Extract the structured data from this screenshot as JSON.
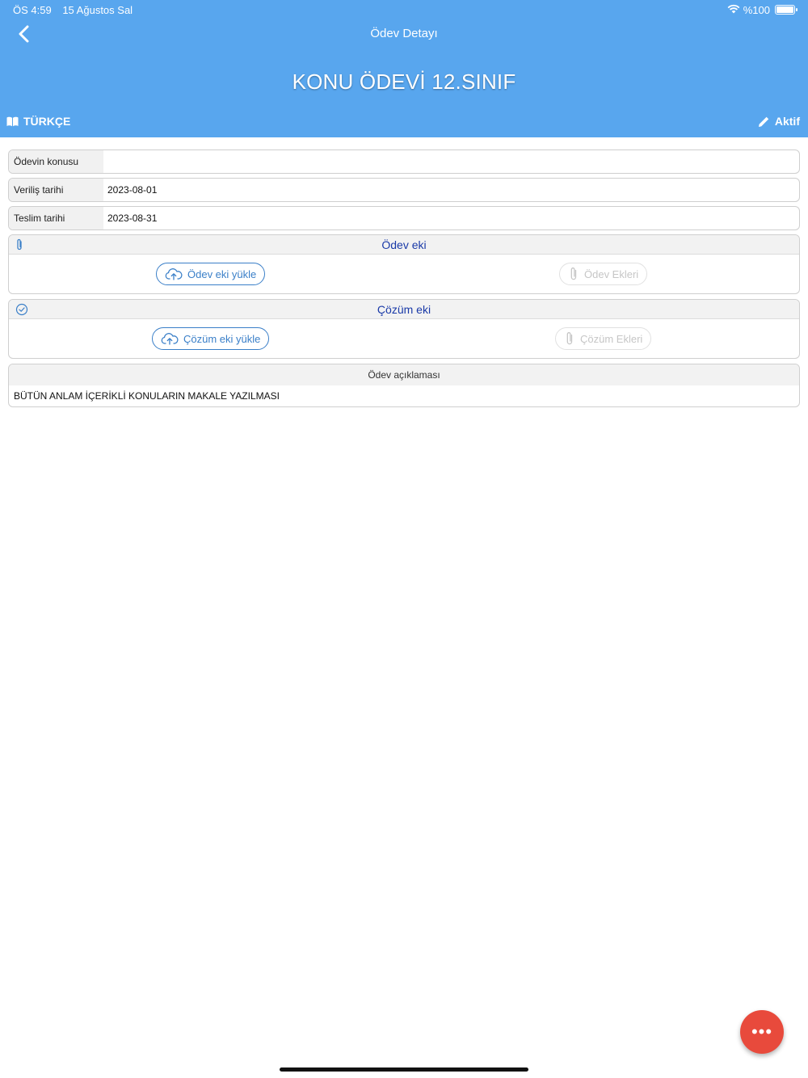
{
  "status_bar": {
    "time": "ÖS 4:59",
    "date": "15 Ağustos Sal",
    "battery": "%100"
  },
  "header": {
    "nav_title": "Ödev Detayı",
    "title": "KONU ÖDEVİ 12.SINIF",
    "subject": "TÜRKÇE",
    "status": "Aktif"
  },
  "fields": [
    {
      "label": "Ödevin konusu",
      "value": ""
    },
    {
      "label": "Veriliş tarihi",
      "value": "2023-08-01"
    },
    {
      "label": "Teslim tarihi",
      "value": "2023-08-31"
    }
  ],
  "homework_attachment": {
    "title": "Ödev eki",
    "upload_label": "Ödev eki yükle",
    "list_label": "Ödev Ekleri"
  },
  "solution_attachment": {
    "title": "Çözüm eki",
    "upload_label": "Çözüm eki yükle",
    "list_label": "Çözüm Ekleri"
  },
  "description": {
    "title": "Ödev açıklaması",
    "text": "BÜTÜN ANLAM İÇERİKLİ KONULARIN MAKALE YAZILMASI"
  },
  "fab": {
    "label": "•••"
  },
  "colors": {
    "header": "#58a6ee",
    "accent": "#3a7fc8",
    "fab": "#e84a3c"
  }
}
